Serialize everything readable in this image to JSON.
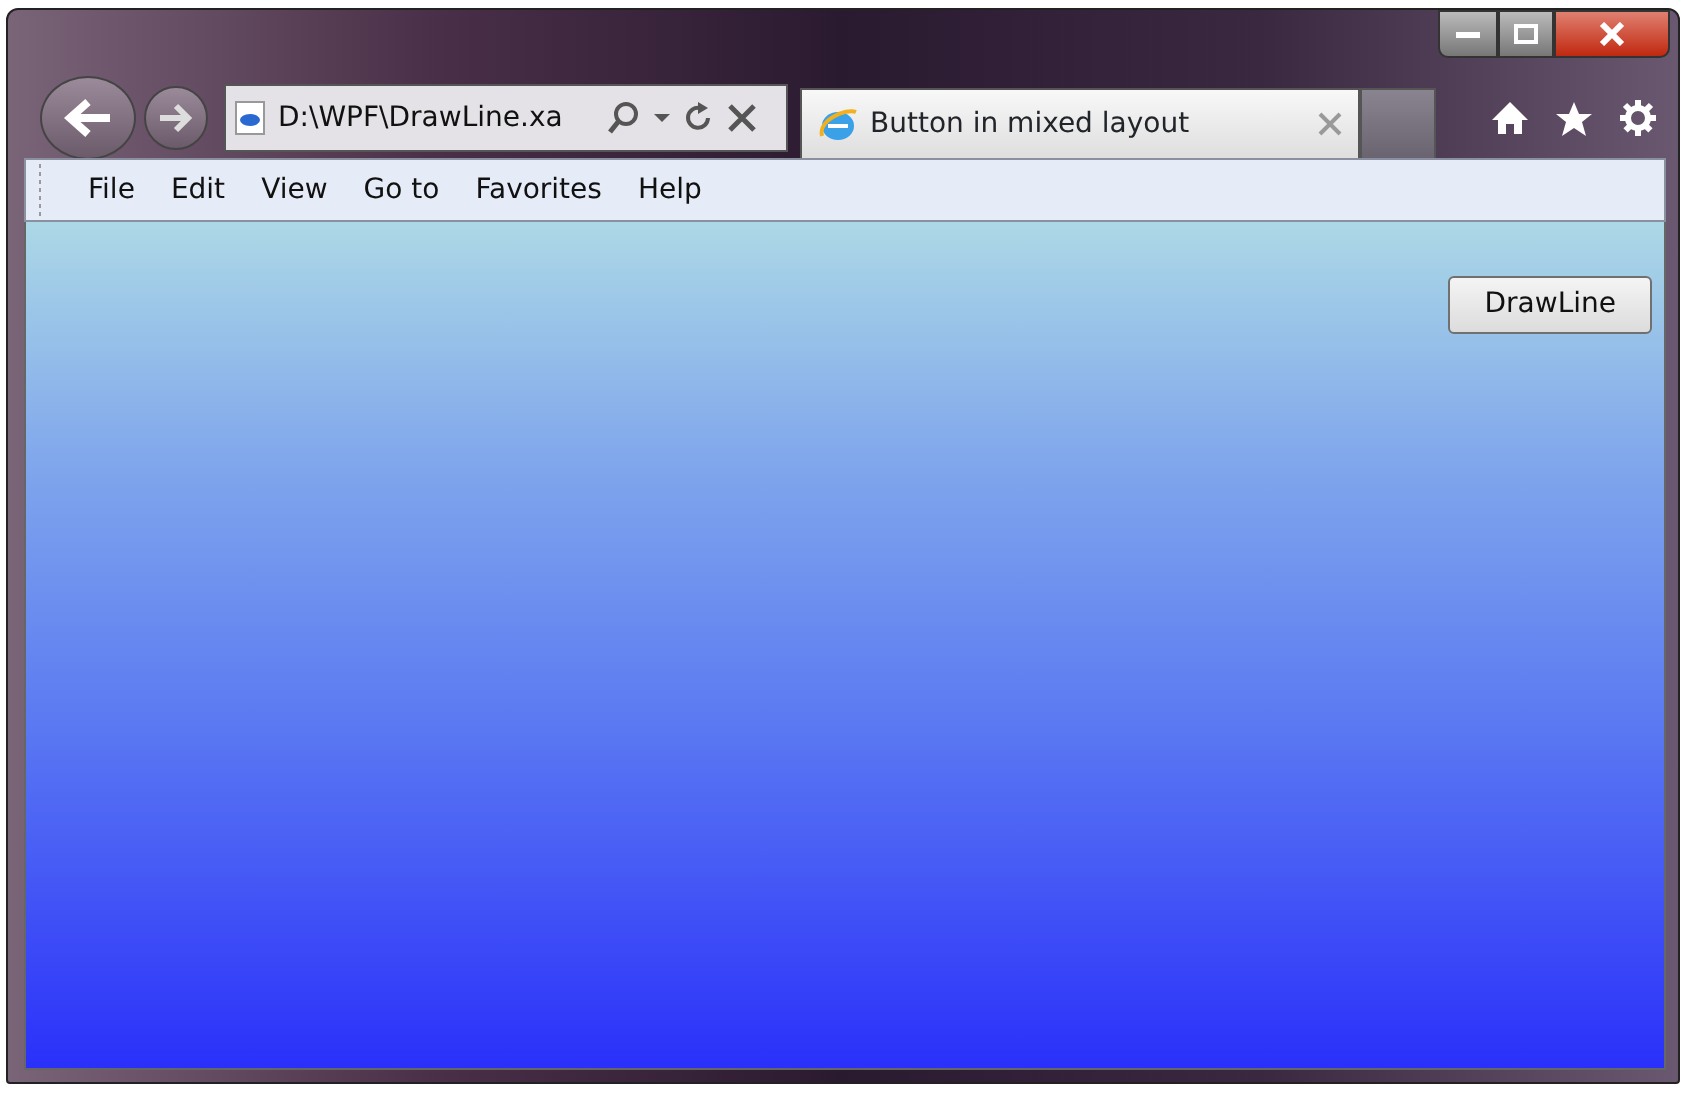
{
  "address_bar": {
    "value": "D:\\WPF\\DrawLine.xa"
  },
  "tabs": [
    {
      "label": "Button in mixed layout",
      "selected": true
    }
  ],
  "menu": [
    "File",
    "Edit",
    "View",
    "Go to",
    "Favorites",
    "Help"
  ],
  "content": {
    "button": "DrawLine"
  }
}
